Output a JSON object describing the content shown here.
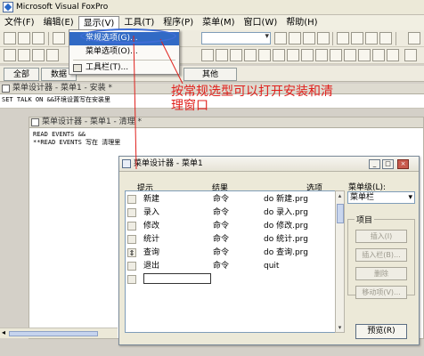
{
  "app": {
    "title": "Microsoft Visual FoxPro"
  },
  "menubar": {
    "items": [
      {
        "label": "文件(F)"
      },
      {
        "label": "编辑(E)"
      },
      {
        "label": "显示(V)"
      },
      {
        "label": "工具(T)"
      },
      {
        "label": "程序(P)"
      },
      {
        "label": "菜单(M)"
      },
      {
        "label": "窗口(W)"
      },
      {
        "label": "帮助(H)"
      }
    ]
  },
  "dropdown": {
    "items": [
      {
        "label": "常规选项(G)..."
      },
      {
        "label": "菜单选项(O)..."
      },
      {
        "label": "工具栏(T)..."
      }
    ]
  },
  "tabs": [
    "全部",
    "数据",
    "其他"
  ],
  "annotation": {
    "text": "按常规选型可以打开安装和清理窗口"
  },
  "setup_window": {
    "title": "菜单设计器 - 菜单1 - 安装 *",
    "code": "SET TALK ON   &&环境设置写在安装里"
  },
  "cleanup_window": {
    "title": "菜单设计器 - 菜单1 - 清理 *",
    "code_line1": "READ EVENTS   &&",
    "code_line2": "**READ EVENTS 写在 清理里"
  },
  "menu_designer": {
    "title": "菜单设计器 - 菜单1",
    "headers": {
      "prompt": "提示",
      "result": "结果",
      "options": "选项"
    },
    "rows": [
      {
        "prompt": "新建",
        "result": "命令",
        "option": "do 新建.prg",
        "mover": ""
      },
      {
        "prompt": "录入",
        "result": "命令",
        "option": "do 录入.prg",
        "mover": ""
      },
      {
        "prompt": "修改",
        "result": "命令",
        "option": "do 修改.prg",
        "mover": ""
      },
      {
        "prompt": "统计",
        "result": "命令",
        "option": "do 统计.prg",
        "mover": ""
      },
      {
        "prompt": "查询",
        "result": "命令",
        "option": "do 查询.prg",
        "mover": "⇕"
      },
      {
        "prompt": "退出",
        "result": "命令",
        "option": "quit",
        "mover": ""
      }
    ],
    "menu_level_label": "菜单级(L):",
    "menu_level_value": "菜单栏",
    "item_group_label": "项目",
    "buttons": {
      "insert": "插入(I)",
      "insert_bar": "插入栏(B)...",
      "delete": "删除",
      "move_item": "移动项(V)...",
      "preview": "预览(R)"
    }
  }
}
